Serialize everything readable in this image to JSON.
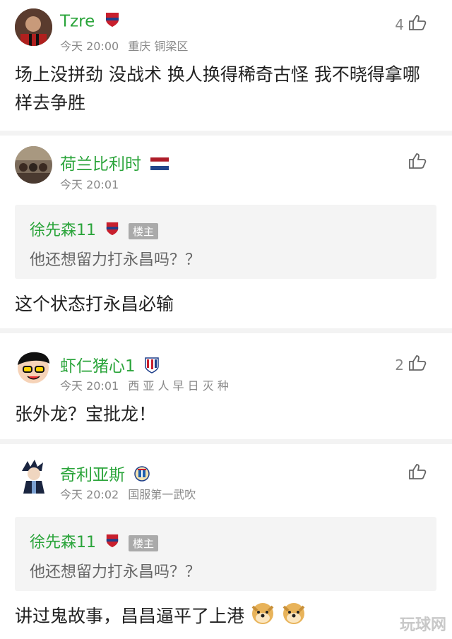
{
  "comments": [
    {
      "user": "Tzre",
      "time": "今天 20:00",
      "location": "重庆 铜梁区",
      "likes": "4",
      "text": "场上没拼劲 没战术 换人换得稀奇古怪 我不晓得拿哪样去争胜"
    },
    {
      "user": "荷兰比利时",
      "time": "今天 20:01",
      "location": "",
      "likes": "",
      "quote": {
        "user": "徐先森11",
        "tag": "楼主",
        "text": "他还想留力打永昌吗？？"
      },
      "text": "这个状态打永昌必输"
    },
    {
      "user": "虾仁猪心1",
      "time": "今天 20:01",
      "location": "西 亚 人 早 日 灭 种",
      "likes": "2",
      "text": "张外龙？宝批龙！"
    },
    {
      "user": "奇利亚斯",
      "time": "今天 20:02",
      "location": "国服第一武吹",
      "likes": "",
      "quote": {
        "user": "徐先森11",
        "tag": "楼主",
        "text": "他还想留力打永昌吗？？"
      },
      "text": "讲过鬼故事，昌昌逼平了上港"
    }
  ],
  "watermark": "玩球网"
}
